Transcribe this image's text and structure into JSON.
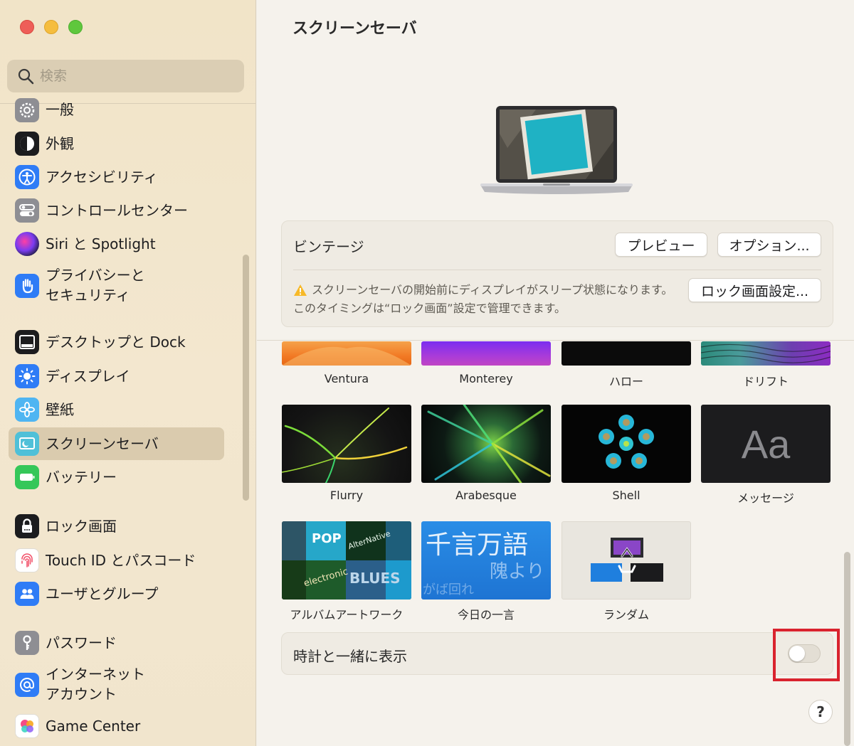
{
  "search": {
    "placeholder": "検索"
  },
  "sidebar": {
    "items": [
      {
        "label": "一般",
        "icon": "gear-icon"
      },
      {
        "label": "外観",
        "icon": "appearance-icon"
      },
      {
        "label": "アクセシビリティ",
        "icon": "accessibility-icon"
      },
      {
        "label": "コントロールセンター",
        "icon": "control-center-icon"
      },
      {
        "label": "Siri と Spotlight",
        "icon": "siri-icon"
      },
      {
        "label": "プライバシーと\nセキュリティ",
        "icon": "hand-icon"
      },
      {
        "label": "デスクトップと Dock",
        "icon": "dock-icon"
      },
      {
        "label": "ディスプレイ",
        "icon": "sun-icon"
      },
      {
        "label": "壁紙",
        "icon": "flower-icon"
      },
      {
        "label": "スクリーンセーバ",
        "icon": "screensaver-icon",
        "selected": true
      },
      {
        "label": "バッテリー",
        "icon": "battery-icon"
      },
      {
        "label": "ロック画面",
        "icon": "lock-icon"
      },
      {
        "label": "Touch ID とパスコード",
        "icon": "fingerprint-icon"
      },
      {
        "label": "ユーザとグループ",
        "icon": "users-icon"
      },
      {
        "label": "パスワード",
        "icon": "key-icon"
      },
      {
        "label": "インターネット\nアカウント",
        "icon": "at-icon"
      },
      {
        "label": "Game Center",
        "icon": "game-center-icon"
      }
    ]
  },
  "main": {
    "title": "スクリーンセーバ",
    "selected_saver": "ビンテージ",
    "preview_label": "プレビュー",
    "options_label": "オプション...",
    "lock_settings_label": "ロック画面設定...",
    "warning_text": "スクリーンセーバの開始前にディスプレイがスリープ状態になります。このタイミングは“ロック画面”設定で管理できます。",
    "savers": [
      {
        "label": "Ventura"
      },
      {
        "label": "Monterey"
      },
      {
        "label": "ハロー"
      },
      {
        "label": "ドリフト"
      },
      {
        "label": "Flurry"
      },
      {
        "label": "Arabesque"
      },
      {
        "label": "Shell"
      },
      {
        "label": "メッセージ",
        "thumb_text": "Aa"
      },
      {
        "label": "アルバムアートワーク",
        "thumb_text": [
          "POP",
          "AlterNative",
          "electronic",
          "BLUES"
        ]
      },
      {
        "label": "今日の一言",
        "thumb_text": [
          "千言万語",
          "隗より",
          "がば回れ"
        ]
      },
      {
        "label": "ランダム"
      }
    ],
    "clock_label": "時計と一緒に表示",
    "clock_enabled": false,
    "help_label": "?"
  },
  "colors": {
    "highlight": "#d9232e",
    "accent": "#2f7cf6"
  }
}
